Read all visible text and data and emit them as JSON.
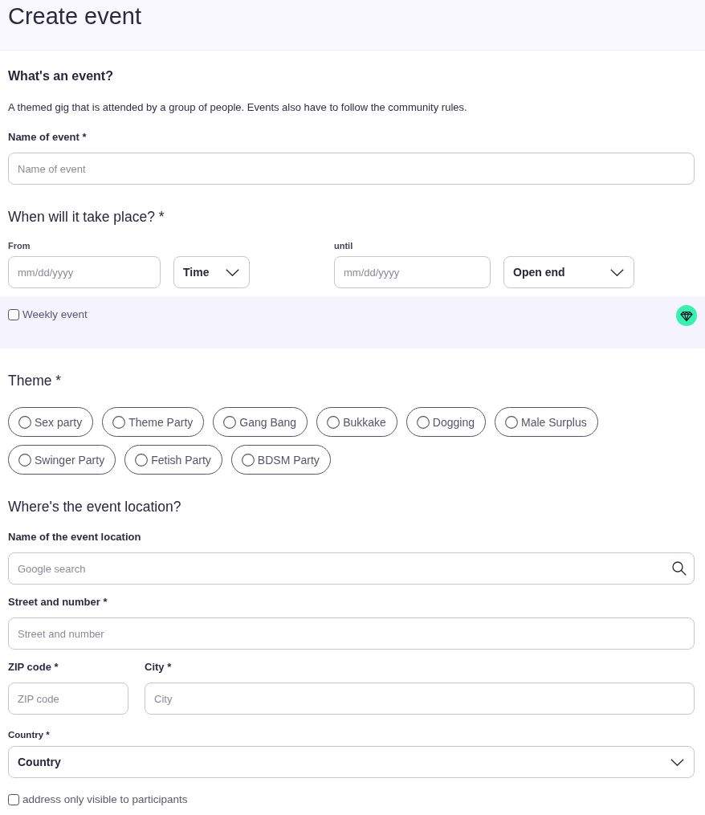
{
  "header": {
    "title": "Create event"
  },
  "intro": {
    "heading": "What's an event?",
    "text": "A themed gig that is attended by a group of people. Events also have to follow the community rules."
  },
  "event_name": {
    "label": "Name of event *",
    "placeholder": "Name of event"
  },
  "schedule": {
    "heading": "When will it take place? *",
    "from": {
      "label": "From",
      "date_placeholder": "mm/dd/yyyy",
      "time": "Time"
    },
    "until": {
      "label": "until",
      "date_placeholder": "mm/dd/yyyy",
      "time": "Open end"
    },
    "weekly": {
      "label": "Weekly event",
      "checked": false
    }
  },
  "theme": {
    "heading": "Theme *",
    "options": [
      {
        "label": "Sex party",
        "selected": false
      },
      {
        "label": "Theme Party",
        "selected": false
      },
      {
        "label": "Gang Bang",
        "selected": false
      },
      {
        "label": "Bukkake",
        "selected": false
      },
      {
        "label": "Dogging",
        "selected": false
      },
      {
        "label": "Male Surplus",
        "selected": false
      },
      {
        "label": "Swinger Party",
        "selected": false
      },
      {
        "label": "Fetish Party",
        "selected": false
      },
      {
        "label": "BDSM Party",
        "selected": false
      }
    ]
  },
  "location": {
    "heading": "Where's the event location?",
    "venue": {
      "label": "Name of the event location",
      "placeholder": "Google search"
    },
    "street": {
      "label": "Street and number *",
      "placeholder": "Street and number"
    },
    "zip": {
      "label": "ZIP code *",
      "placeholder": "ZIP code"
    },
    "city": {
      "label": "City *",
      "placeholder": "City"
    },
    "country": {
      "label": "Country *",
      "value": "Country"
    },
    "private_address": {
      "label": "address only visible to participants",
      "checked": false
    }
  }
}
